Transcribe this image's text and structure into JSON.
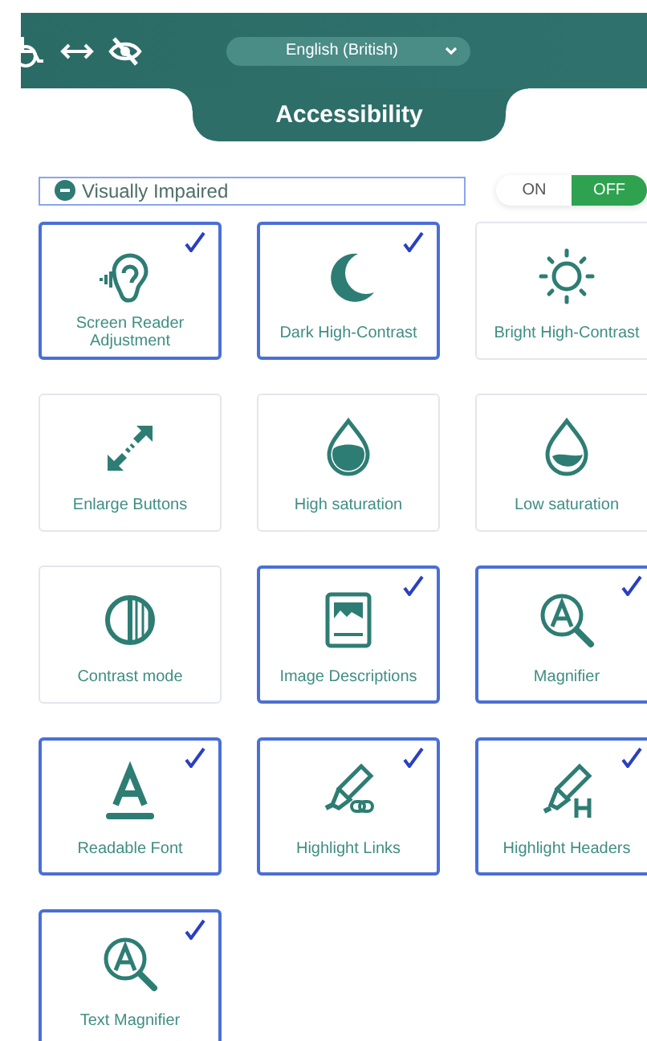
{
  "header": {
    "language": "English (British)",
    "title": "Accessibility"
  },
  "profile": {
    "value": "Visually Impaired"
  },
  "toggle": [
    {
      "label": "ON",
      "selected": false
    },
    {
      "label": "OFF",
      "selected": true
    }
  ],
  "cards": [
    {
      "label": "Screen Reader Adjustment",
      "checked": true
    },
    {
      "label": "Dark High-Contrast",
      "checked": true
    },
    {
      "label": "Bright High-Contrast",
      "checked": false
    },
    {
      "label": "Enlarge Buttons",
      "checked": false
    },
    {
      "label": "High saturation",
      "checked": false
    },
    {
      "label": "Low saturation",
      "checked": false
    },
    {
      "label": "Contrast mode",
      "checked": false
    },
    {
      "label": "Image Descriptions",
      "checked": true
    },
    {
      "label": "Magnifier",
      "checked": true
    },
    {
      "label": "Readable Font",
      "checked": true
    },
    {
      "label": "Highlight Links",
      "checked": true
    },
    {
      "label": "Highlight Headers",
      "checked": true
    },
    {
      "label": "Text Magnifier",
      "checked": true
    }
  ]
}
